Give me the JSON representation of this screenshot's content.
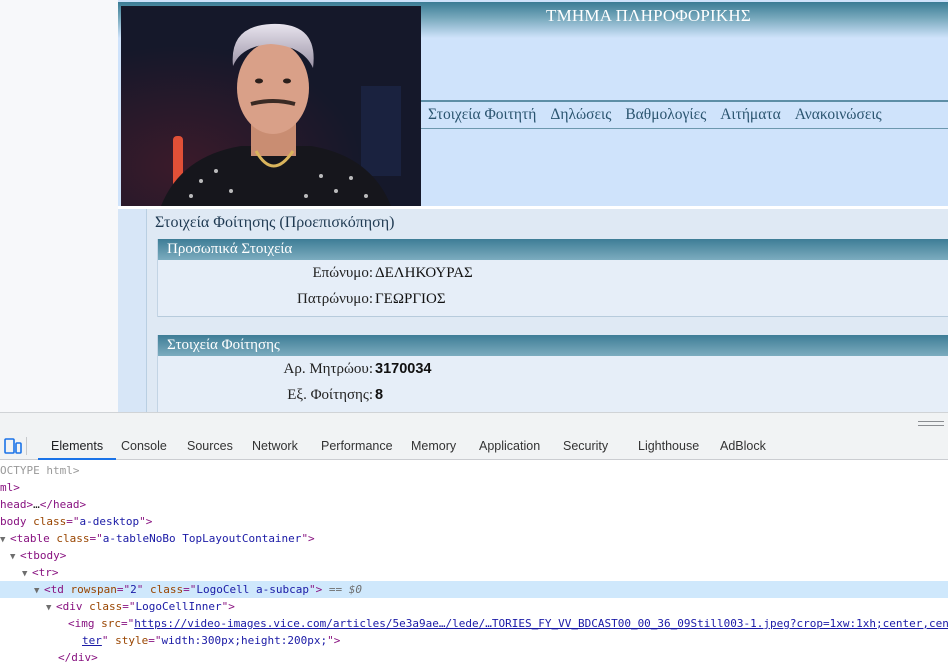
{
  "site": {
    "title": "ΤΜΗΜΑ ΠΛΗΡΟΦΟΡΙΚΗΣ",
    "nav": [
      "Στοιχεία Φοιτητή",
      "Δηλώσεις",
      "Βαθμολογίες",
      "Αιτήματα",
      "Ανακοινώσεις"
    ]
  },
  "logo": {
    "icon": "student-photo"
  },
  "section_title": "Στοιχεία Φοίτησης (Προεπισκόπηση)",
  "personal": {
    "heading": "Προσωπικά Στοιχεία",
    "surname_label": "Επώνυμο:",
    "surname_value": "ΔΕΛΗΚΟΥΡΑΣ",
    "father_label": "Πατρώνυμο:",
    "father_value": "ΓΕΩΡΓΙΟΣ"
  },
  "studies": {
    "heading": "Στοιχεία Φοίτησης",
    "reg_label": "Αρ. Μητρώου:",
    "reg_value": "3170034",
    "semester_label": "Εξ. Φοίτησης:",
    "semester_value": "8"
  },
  "devtools": {
    "tabs": [
      "Elements",
      "Console",
      "Sources",
      "Network",
      "Performance",
      "Memory",
      "Application",
      "Security",
      "Lighthouse",
      "AdBlock"
    ],
    "active_tab": "Elements",
    "dom": {
      "doctype": "OCTYPE html>",
      "html": "ml>",
      "head_open": "head>",
      "head_ellipsis": "…",
      "head_close": "</head>",
      "body_tag": "body",
      "body_class": "a-desktop",
      "table_tag": "<table",
      "table_class": "a-tableNoBo TopLayoutContainer",
      "tbody": "<tbody>",
      "tr": "<tr>",
      "td_tag": "<td",
      "td_rowspan": "2",
      "td_class": "LogoCell a-subcap",
      "td_marker": "== $0",
      "div_tag": "<div",
      "div_class": "LogoCellInner",
      "img_tag": "<img",
      "img_src_1": "https://video-images.vice.com/articles/5e3a9ae…/lede/…TORIES_FY_VV_BDCAST00_00_36_09Still003-1.jpeg?crop=1xw:1xh;center,cen",
      "img_src_2": "ter",
      "img_style": "width:300px;height:200px;",
      "div_close": "</div>"
    }
  },
  "colors": {
    "header_gradient_top": "#3a7c95",
    "page_bg": "#cfe3fb",
    "nav_text": "#2b5570",
    "devtools_accent": "#1a73e8",
    "selected_row": "#cfe8fc"
  }
}
